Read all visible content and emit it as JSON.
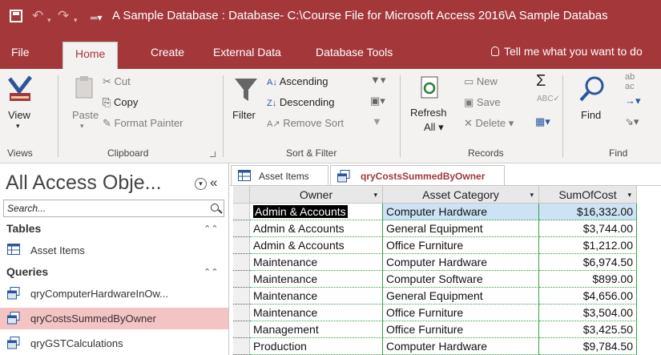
{
  "window": {
    "title": "A Sample Database : Database- C:\\Course File for Microsoft Access 2016\\A Sample Databas"
  },
  "ribbon_tabs": [
    "File",
    "Home",
    "Create",
    "External Data",
    "Database Tools"
  ],
  "tell_me": "Tell me what you want to do",
  "ribbon": {
    "views": {
      "view": "View",
      "group": "Views"
    },
    "clipboard": {
      "paste": "Paste",
      "cut": "Cut",
      "copy": "Copy",
      "format_painter": "Format Painter",
      "group": "Clipboard"
    },
    "sort_filter": {
      "filter": "Filter",
      "ascending": "Ascending",
      "descending": "Descending",
      "remove_sort": "Remove Sort",
      "group": "Sort & Filter"
    },
    "records": {
      "refresh": "Refresh",
      "refresh_all": "All",
      "new": "New",
      "save": "Save",
      "delete": "Delete",
      "group": "Records"
    },
    "find": {
      "find": "Find",
      "group": "Find"
    }
  },
  "nav": {
    "title": "All Access Obje...",
    "search_placeholder": "Search...",
    "sections": [
      {
        "label": "Tables",
        "items": [
          {
            "label": "Asset Items",
            "icon": "table-icon"
          }
        ]
      },
      {
        "label": "Queries",
        "items": [
          {
            "label": "qryComputerHardwareInOw...",
            "icon": "query-icon"
          },
          {
            "label": "qryCostsSummedByOwner",
            "icon": "query-icon",
            "selected": true
          },
          {
            "label": "qryGSTCalculations",
            "icon": "query-icon"
          }
        ]
      }
    ]
  },
  "doc_tabs": [
    {
      "label": "Asset Items",
      "icon": "table-icon"
    },
    {
      "label": "qryCostsSummedByOwner",
      "icon": "query-icon",
      "active": true
    }
  ],
  "datasheet": {
    "columns": [
      "Owner",
      "Asset Category",
      "SumOfCost"
    ],
    "rows": [
      [
        "Admin & Accounts",
        "Computer Hardware",
        "$16,332.00"
      ],
      [
        "Admin & Accounts",
        "General Equipment",
        "$3,744.00"
      ],
      [
        "Admin & Accounts",
        "Office Furniture",
        "$1,212.00"
      ],
      [
        "Maintenance",
        "Computer Hardware",
        "$6,974.50"
      ],
      [
        "Maintenance",
        "Computer Software",
        "$899.00"
      ],
      [
        "Maintenance",
        "General Equipment",
        "$4,656.00"
      ],
      [
        "Maintenance",
        "Office Furniture",
        "$3,504.00"
      ],
      [
        "Management",
        "Office Furniture",
        "$3,425.50"
      ],
      [
        "Production",
        "Computer Hardware",
        "$9,784.50"
      ]
    ]
  },
  "colors": {
    "accent": "#a4373a",
    "selection": "#cde3f5",
    "nav_selected": "#f4c4c4"
  }
}
